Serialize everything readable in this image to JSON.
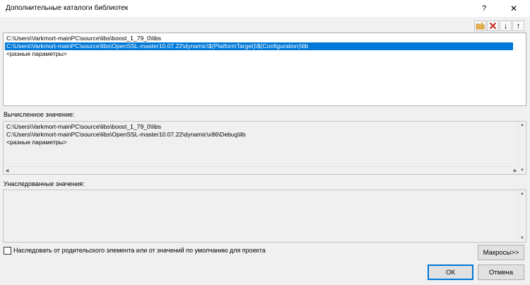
{
  "window": {
    "title": "Дополнительные каталоги библиотек",
    "help": "?",
    "close": "✕"
  },
  "toolbar": {
    "new_folder_icon": "new-folder-icon",
    "delete_icon": "delete-icon",
    "move_down": "↓",
    "move_up": "↑"
  },
  "editor": {
    "items": [
      "C:\\Users\\Varkmort-mainPC\\source\\libs\\boost_1_79_0\\libs",
      "C:\\Users\\Varkmort-mainPC\\source\\libs\\OpenSSL-master10.07.22\\dynamic\\$(PlatformTarget)\\$(Configuration)\\lib",
      "<разные параметры>"
    ],
    "selected_index": 1
  },
  "computed": {
    "label": "Вычисленное значение:",
    "items": [
      "C:\\Users\\Varkmort-mainPC\\source\\libs\\boost_1_79_0\\libs",
      "C:\\Users\\Varkmort-mainPC\\source\\libs\\OpenSSL-master10.07.22\\dynamic\\x86\\Debug\\lib",
      "<разные параметры>"
    ]
  },
  "inherited": {
    "label": "Унаследованные значения:",
    "items": []
  },
  "inherit_checkbox": {
    "label": "Наследовать от родительского элемента или от значений по умолчанию для проекта",
    "checked": false
  },
  "buttons": {
    "macros": "Макросы>>",
    "ok": "ОК",
    "cancel": "Отмена"
  },
  "colors": {
    "selection": "#0078d7",
    "delete_icon": "#c42b1c",
    "folder_icon": "#e8b04a"
  }
}
